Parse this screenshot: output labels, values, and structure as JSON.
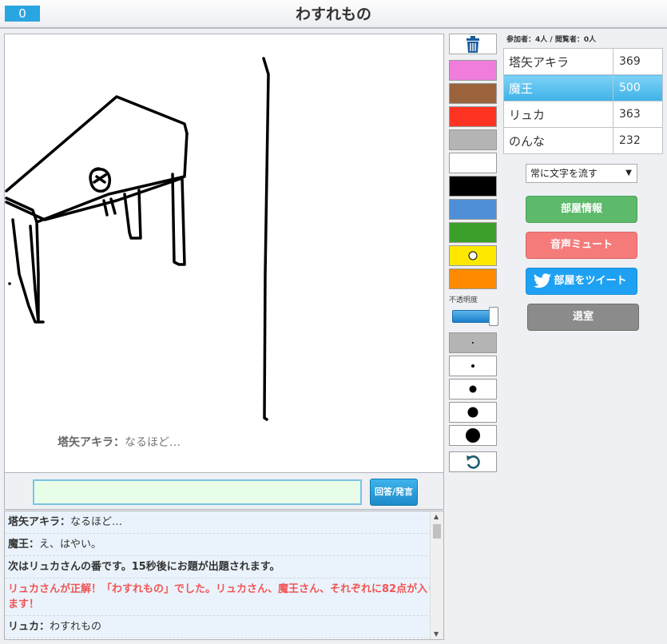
{
  "header": {
    "counter": "0",
    "title": "わすれもの"
  },
  "canvas": {
    "message_name": "塔矢アキラ：",
    "message_text": "なるほど…"
  },
  "answer": {
    "input_value": "",
    "button_label": "回答/発言"
  },
  "chat": [
    {
      "name": "塔矢アキラ：",
      "text": "なるほど…",
      "kind": "user"
    },
    {
      "name": "魔王：",
      "text": "え、はやい。",
      "kind": "user"
    },
    {
      "name": "",
      "text": "次はリュカさんの番です。15秒後にお題が出題されます。",
      "kind": "sys"
    },
    {
      "name": "",
      "text": "リュカさんが正解！「わすれもの」でした。リュカさん、魔王さん、それぞれに82点が入ります！",
      "kind": "correct"
    },
    {
      "name": "リュカ：",
      "text": "わすれもの",
      "kind": "user"
    }
  ],
  "tools": {
    "trash_icon": "trash-icon",
    "colors": [
      "#f07ddc",
      "#9b633b",
      "#ff3322",
      "#b4b4b4",
      "#ffffff",
      "#000000",
      "#4e8fd8",
      "#3d9f2b",
      "#ffe800",
      "#ff8a00"
    ],
    "selected_color_index": 8,
    "opacity_label": "不透明度",
    "opacity_value": 1.0,
    "brush_sizes": [
      2,
      4,
      9,
      13,
      18
    ],
    "selected_brush_index": 0,
    "undo_icon": "undo-icon"
  },
  "side": {
    "participants": "参加者：4人 / 閲覧者：0人",
    "players": [
      {
        "name": "塔矢アキラ",
        "score": "369",
        "active": false
      },
      {
        "name": "魔王",
        "score": "500",
        "active": true
      },
      {
        "name": "リュカ",
        "score": "363",
        "active": false
      },
      {
        "name": "のんな",
        "score": "232",
        "active": false
      }
    ],
    "scroll_select": "常に文字を流す",
    "room_info": "部屋情報",
    "mute": "音声ミュート",
    "tweet": "部屋をツイート",
    "exit": "退室"
  }
}
